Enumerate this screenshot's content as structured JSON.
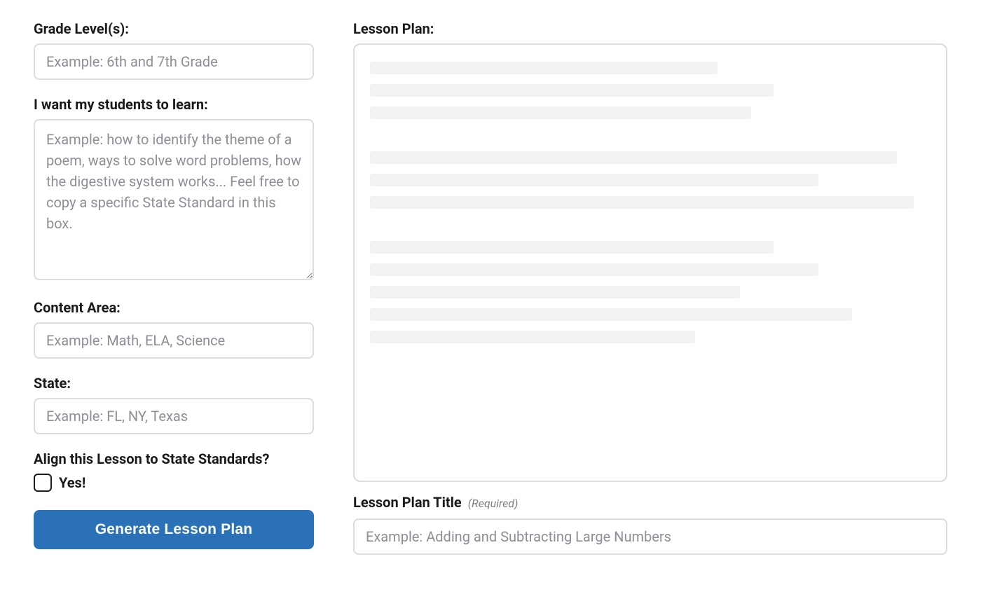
{
  "form": {
    "grade_level": {
      "label": "Grade Level(s):",
      "placeholder": "Example: 6th and 7th Grade",
      "value": ""
    },
    "learn": {
      "label": "I want my students to learn:",
      "placeholder": "Example: how to identify the theme of a poem, ways to solve word problems, how the digestive system works... Feel free to copy a specific State Standard in this box.",
      "value": ""
    },
    "content_area": {
      "label": "Content Area:",
      "placeholder": "Example: Math, ELA, Science",
      "value": ""
    },
    "state": {
      "label": "State:",
      "placeholder": "Example: FL, NY, Texas",
      "value": ""
    },
    "align_standards": {
      "label": "Align this Lesson to State Standards?",
      "checkbox_label": "Yes!",
      "checked": false
    },
    "submit_label": "Generate Lesson Plan"
  },
  "output": {
    "heading": "Lesson Plan:",
    "skeleton_widths": [
      [
        "62%",
        "72%",
        "68%"
      ],
      [
        "94%",
        "80%",
        "97%"
      ],
      [
        "72%",
        "80%",
        "66%",
        "86%",
        "58%"
      ]
    ]
  },
  "title_field": {
    "label": "Lesson Plan Title",
    "required_hint": "(Required)",
    "placeholder": "Example: Adding and Subtracting Large Numbers",
    "value": ""
  }
}
